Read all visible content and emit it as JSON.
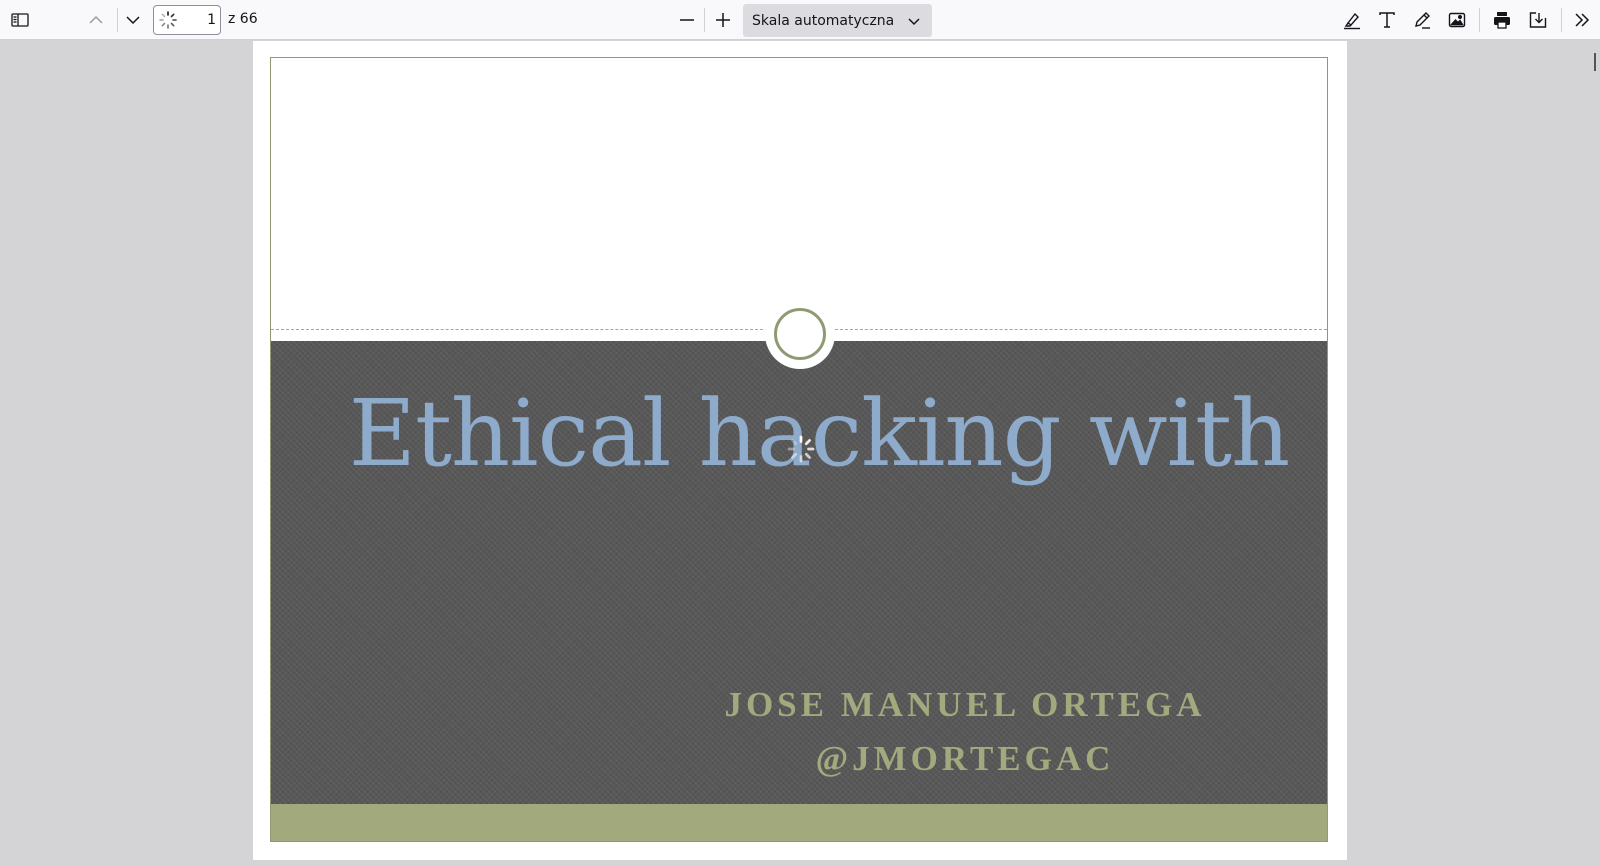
{
  "toolbar": {
    "page_number": "1",
    "page_count": "z 66",
    "scale": "Skala automatyczna",
    "icons": {
      "sidebar": "sidebar-toggle-icon",
      "prev": "chevron-up-icon",
      "next": "chevron-down-icon",
      "zoom_out": "minus-icon",
      "zoom_in": "plus-icon",
      "highlight": "highlighter-icon",
      "text": "text-icon",
      "draw": "pencil-icon",
      "image": "image-icon",
      "print": "printer-icon",
      "save": "download-icon",
      "more": "double-chevron-right-icon"
    }
  },
  "slide": {
    "title": "Ethical hacking with",
    "author": "JOSE MANUEL ORTEGA",
    "handle": "@JMORTEGAC"
  },
  "colors": {
    "title": "#8eabcc",
    "accent": "#a2a97d",
    "dark": "#585858"
  }
}
